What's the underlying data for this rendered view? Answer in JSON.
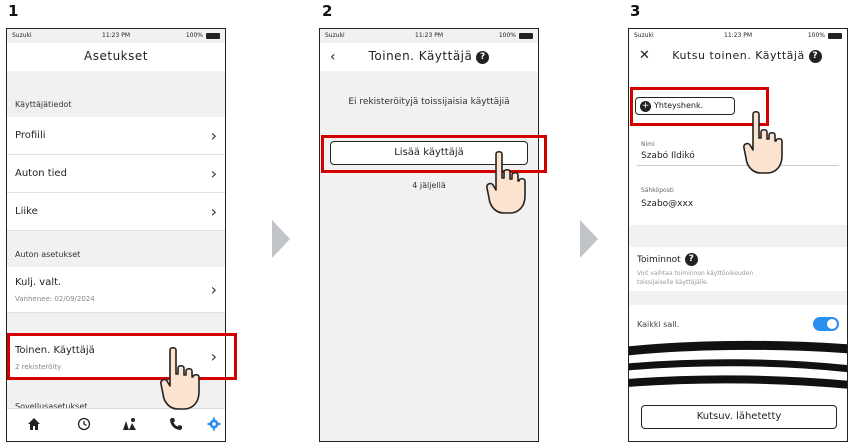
{
  "steps": [
    "1",
    "2",
    "3"
  ],
  "status": {
    "carrier": "Suzuki",
    "time": "11:23 PM",
    "battery": "100%"
  },
  "screen1": {
    "title": "Asetukset",
    "sections": {
      "user_info": "Käyttäjätiedot",
      "car_settings": "Auton asetukset",
      "app_settings": "Sovellusasetukset"
    },
    "rows": {
      "profile": "Profiili",
      "car_info": "Auton tied",
      "motion": "Liike",
      "driver_license": "Kulj. valt.",
      "driver_license_sub": "Vanhenee: 02/09/2024",
      "secondary_user": "Toinen. Käyttäjä",
      "secondary_user_sub": "2 rekisteröity"
    },
    "tabs": [
      "home-icon",
      "history-icon",
      "map-icon",
      "phone-icon",
      "settings-icon"
    ]
  },
  "screen2": {
    "title": "Toinen. Käyttäjä",
    "empty_message": "Ei rekisteröityjä toissijaisia käyttäjiä",
    "add_button": "Lisää käyttäjä",
    "remaining": "4 jäljellä"
  },
  "screen3": {
    "title": "Kutsu toinen. Käyttäjä",
    "contacts_button": "Yhteyshenk.",
    "name_label": "Nimi",
    "name_value": "Szabó Ildikó",
    "email_label": "Sähköposti",
    "email_value": "Szabo@xxx",
    "functions_title": "Toiminnot",
    "functions_desc_1": "Voit vaihtaa toiminnon käyttöoikeuden",
    "functions_desc_2": "toissijaiselle käyttäjälle.",
    "allow_all_label": "Kaikki sall.",
    "allow_all_on": true,
    "send_button": "Kutsuv. lähetetty"
  },
  "colors": {
    "highlight": "#d40000",
    "toggle": "#2a8ef0",
    "arrow": "#c0c4c8"
  }
}
